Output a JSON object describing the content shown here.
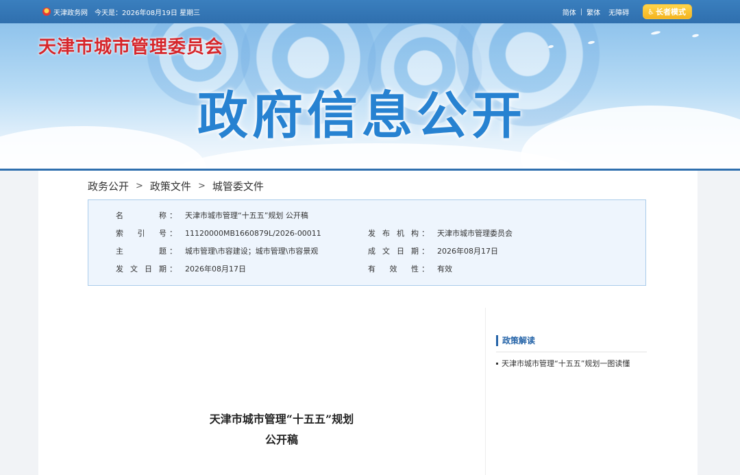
{
  "topbar": {
    "portal": "天津政务网",
    "date": "今天是：2026年08月19日 星期三",
    "links": [
      "简体",
      "繁体",
      "无障碍"
    ],
    "separator": "|",
    "elder_mode": "长者模式"
  },
  "banner": {
    "site_title": "天津市城市管理委员会",
    "heading": "政府信息公开"
  },
  "breadcrumb": [
    "政务公开",
    "政策文件",
    "城管委文件"
  ],
  "breadcrumb_separator": ">",
  "info": {
    "name": {
      "label": [
        "名",
        "称"
      ],
      "value": "天津市城市管理“十五五”规划 公开稿"
    },
    "index_no": {
      "label": [
        "索",
        "引",
        "号"
      ],
      "value": "11120000MB1660879L/2026-00011"
    },
    "publisher": {
      "label": [
        "发",
        "布",
        "机",
        "构"
      ],
      "value": "天津市城市管理委员会"
    },
    "subject": {
      "label": [
        "主",
        "题"
      ],
      "value": "城市管理\\市容建设；城市管理\\市容景观"
    },
    "written_date": {
      "label": [
        "成",
        "文",
        "日",
        "期"
      ],
      "value": "2026年08月17日"
    },
    "issue_date": {
      "label": [
        "发",
        "文",
        "日",
        "期"
      ],
      "value": "2026年08月17日"
    },
    "validity": {
      "label": [
        "有",
        "效",
        "性"
      ],
      "value": "有效"
    },
    "colon": "："
  },
  "sidebar": {
    "heading": "政策解读",
    "items": [
      "天津市城市管理“十五五”规划一图读懂"
    ]
  },
  "document": {
    "title_line1": "天津市城市管理“十五五”规划",
    "title_line2": "公开稿"
  },
  "colors": {
    "brand_blue": "#2f6fae",
    "title_red": "#d6262b",
    "heading_blue": "#2782d1"
  }
}
